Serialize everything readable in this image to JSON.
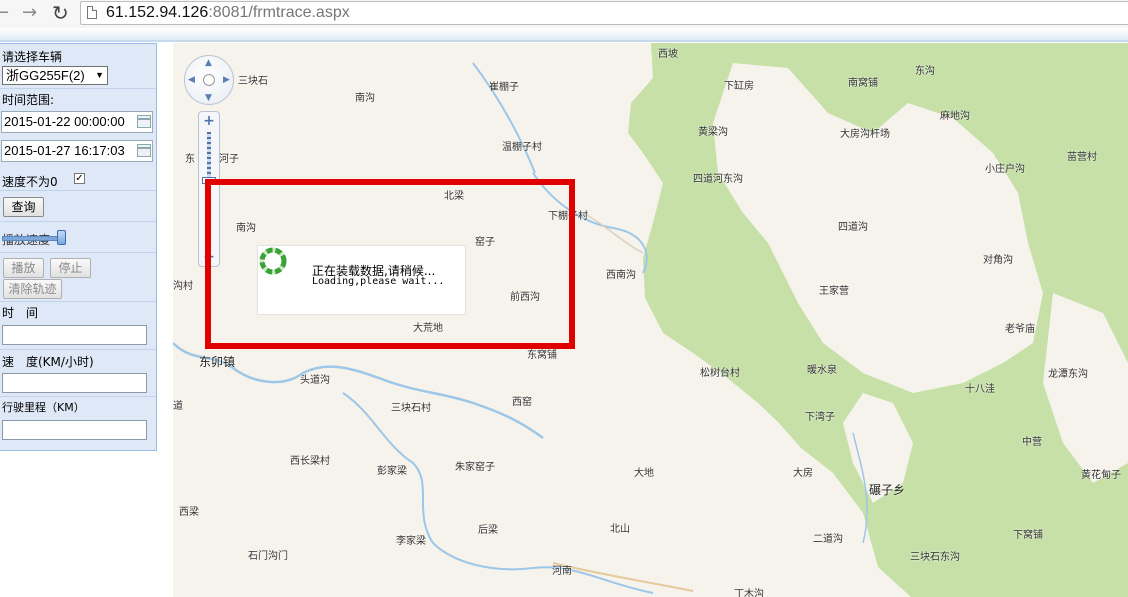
{
  "browser": {
    "url_host": "61.152.94.126",
    "url_rest": ":8081/frmtrace.aspx"
  },
  "panel": {
    "select_vehicle_label": "请选择车辆",
    "vehicle_value": "浙GG255F(2)",
    "time_range_label": "时间范围:",
    "start_time": "2015-01-22 00:00:00",
    "end_time": "2015-01-27 16:17:03",
    "speed_nonzero_label": "速度不为0",
    "speed_nonzero_checked": true,
    "query_button": "查询",
    "play_speed_label": "播放速度",
    "play_button": "播放",
    "stop_button": "停止",
    "clear_track_button": "清除轨迹",
    "time_label": "时　间",
    "speed_label": "速　度(KM/小时)",
    "mileage_label": "行驶里程（KM）",
    "time_value": "",
    "speed_value": "",
    "mileage_value": ""
  },
  "map": {
    "loading_text_cn": "正在装载数据,请稍候...",
    "loading_text_en": "Loading,please wait...",
    "places": [
      "西坡",
      "东沟",
      "下缸房",
      "南窝铺",
      "三块石",
      "南沟",
      "崔棚子",
      "麻地沟",
      "黄梁沟",
      "大房沟杆场",
      "温棚子村",
      "小庄户沟",
      "苗营村",
      "东",
      "河子",
      "四道河东沟",
      "北梁",
      "下棚子村",
      "四道沟",
      "南沟",
      "窑子",
      "对角沟",
      "西南沟",
      "前西沟",
      "王家营",
      "老爷庙",
      "大荒地",
      "沟村",
      "东卯镇",
      "东窝铺",
      "松树台村",
      "暖水泉",
      "龙潭东沟",
      "头道沟",
      "十八洼",
      "道",
      "三块石村",
      "西窑",
      "下湾子",
      "中营",
      "西长梁村",
      "彭家梁",
      "朱家窑子",
      "大地",
      "大房",
      "黄花甸子",
      "碾子乡",
      "西梁",
      "后梁",
      "北山",
      "二道沟",
      "下窝铺",
      "石门沟门",
      "李家梁",
      "河南",
      "三块石东沟",
      "丁木沟"
    ]
  }
}
